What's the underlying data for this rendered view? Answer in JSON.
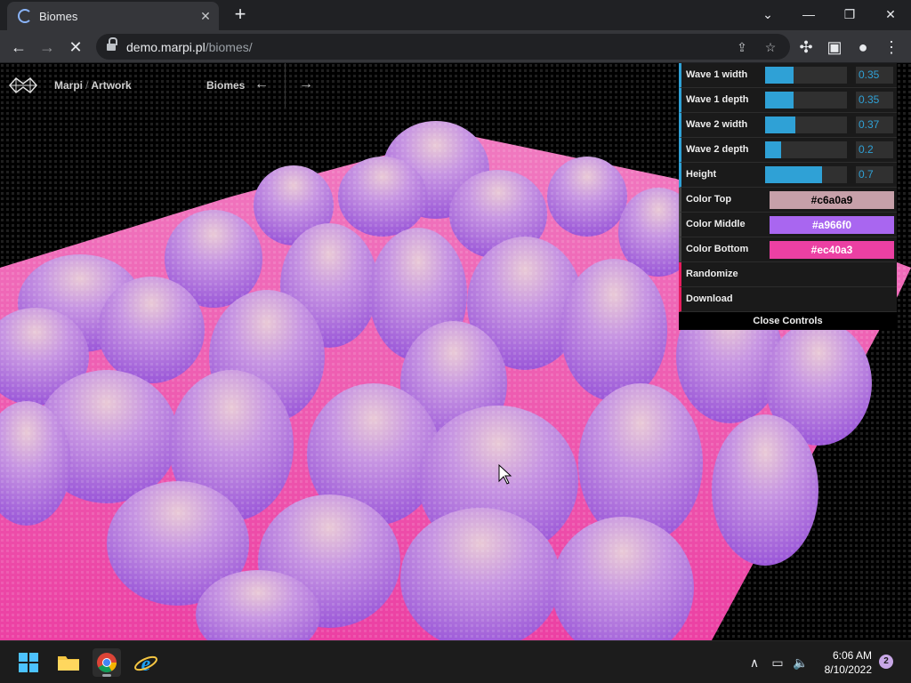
{
  "browser": {
    "tab_title": "Biomes",
    "url_host": "demo.marpi.pl",
    "url_path": "/biomes/"
  },
  "site": {
    "brand": "Marpi",
    "brand_sep": "/",
    "brand_section": "Artwork",
    "page_title": "Biomes",
    "nav_prev_icon": "arrow-left-icon",
    "nav_next_icon": "arrow-right-icon"
  },
  "controls": {
    "sliders": [
      {
        "label": "Wave 1 width",
        "value": "0.35",
        "fraction": 0.35
      },
      {
        "label": "Wave 1 depth",
        "value": "0.35",
        "fraction": 0.35
      },
      {
        "label": "Wave 2 width",
        "value": "0.37",
        "fraction": 0.37
      },
      {
        "label": "Wave 2 depth",
        "value": "0.2",
        "fraction": 0.2
      },
      {
        "label": "Height",
        "value": "0.7",
        "fraction": 0.7
      }
    ],
    "colors": [
      {
        "label": "Color Top",
        "value": "#c6a0a9",
        "text_color": "#000000"
      },
      {
        "label": "Color Middle",
        "value": "#a966f0",
        "text_color": "#ffffff"
      },
      {
        "label": "Color Bottom",
        "value": "#ec40a3",
        "text_color": "#ffffff"
      }
    ],
    "actions": [
      {
        "label": "Randomize"
      },
      {
        "label": "Download"
      }
    ],
    "close_label": "Close Controls"
  },
  "taskbar": {
    "time": "6:06 AM",
    "date": "8/10/2022",
    "notification_count": "2",
    "apps": [
      "windows-start-icon",
      "file-explorer-icon",
      "chrome-icon",
      "internet-explorer-icon"
    ]
  }
}
